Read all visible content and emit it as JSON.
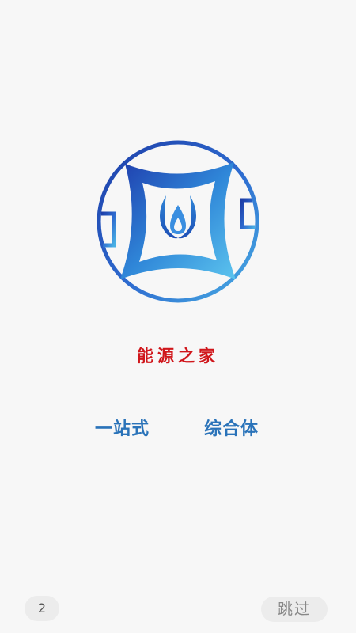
{
  "splash": {
    "brand_name": "能源之家",
    "slogan_left": "一站式",
    "slogan_right": "综合体",
    "countdown": "2",
    "skip_label": "跳过"
  },
  "colors": {
    "logo_blue_dark": "#1d3ea8",
    "logo_blue_light": "#4db3e6",
    "brand_red": "#d0161b",
    "slogan_blue": "#2a73b9",
    "background": "#f7f7f7"
  },
  "icons": {
    "logo": "energy-home-logo-icon"
  }
}
